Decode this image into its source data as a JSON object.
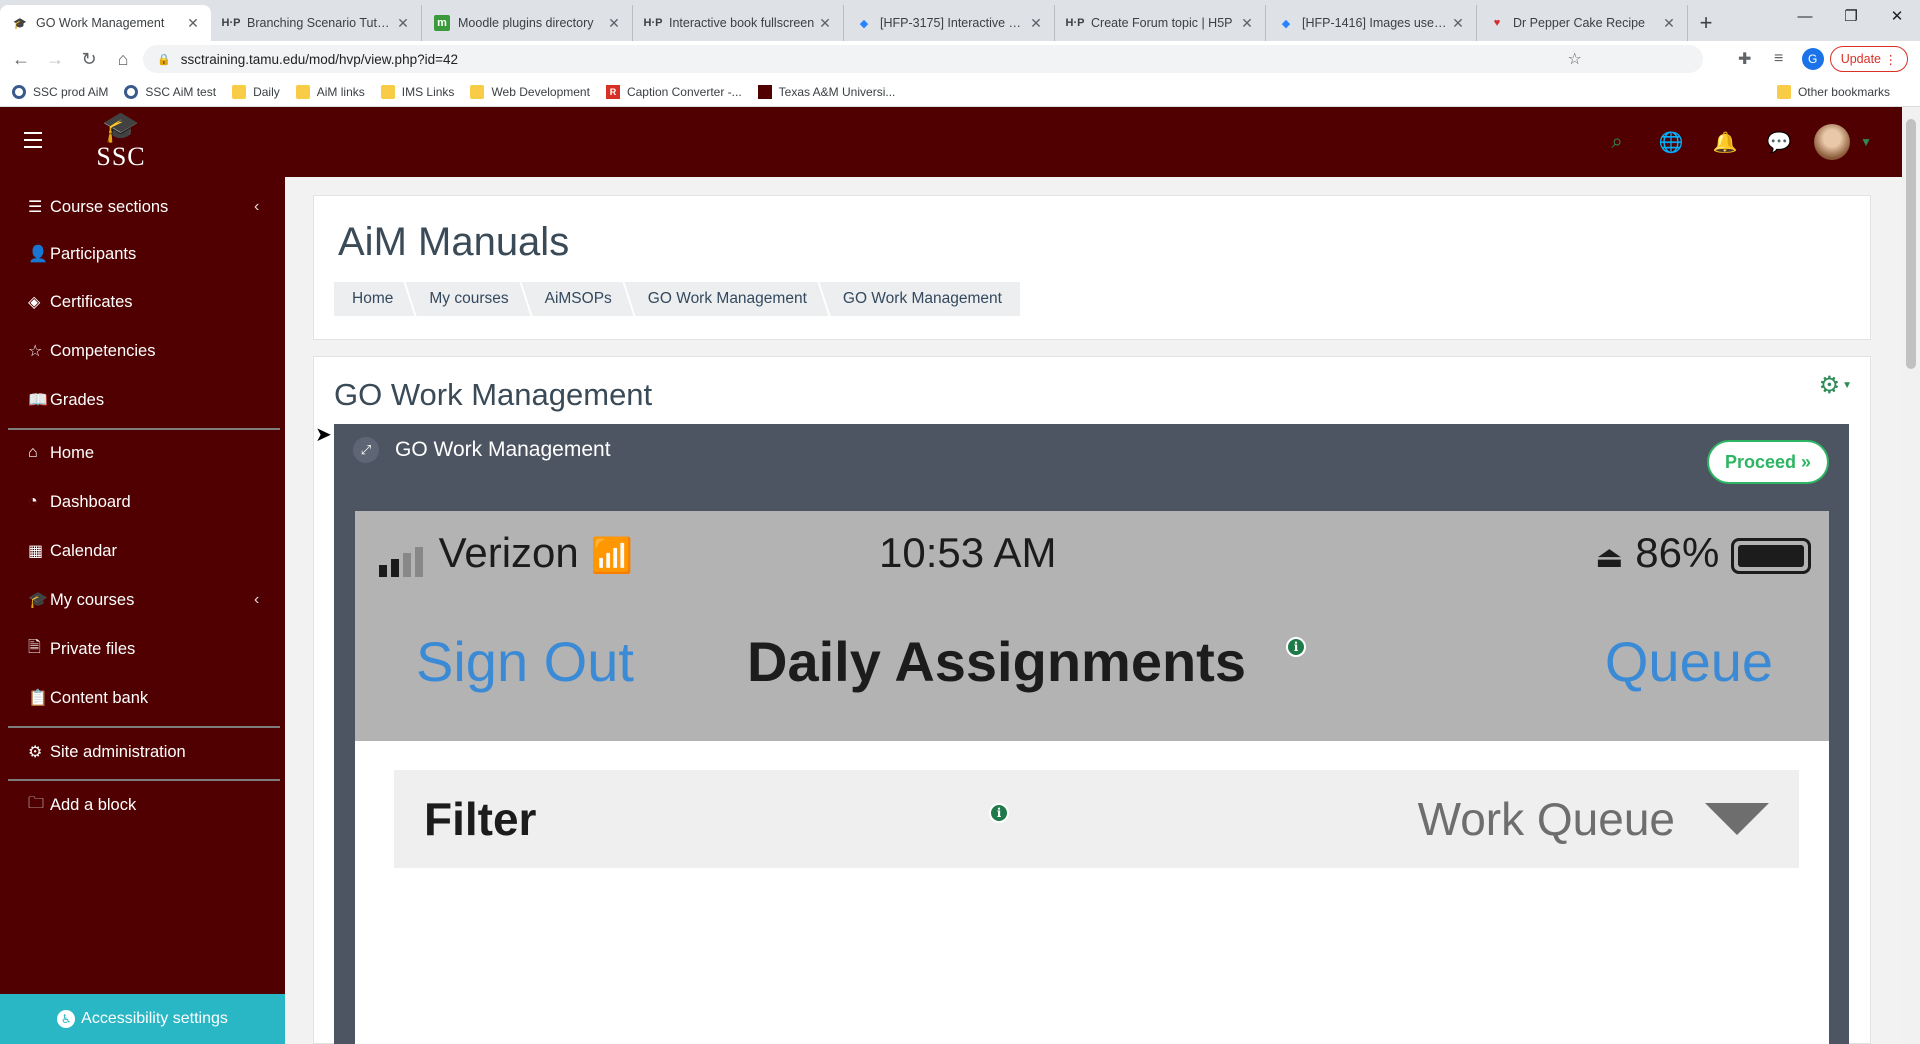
{
  "browser": {
    "tabs": [
      {
        "title": "GO Work Management",
        "favicon": "moodle-icon"
      },
      {
        "title": "Branching Scenario Tutorial",
        "favicon": "h5p-icon"
      },
      {
        "title": "Moodle plugins directory",
        "favicon": "moodle-green-icon"
      },
      {
        "title": "Interactive book fullscreen",
        "favicon": "h5p-icon"
      },
      {
        "title": "[HFP-3175] Interactive Book",
        "favicon": "jira-icon"
      },
      {
        "title": "Create Forum topic | H5P",
        "favicon": "h5p-icon"
      },
      {
        "title": "[HFP-1416] Images uses 100",
        "favicon": "jira-icon"
      },
      {
        "title": "Dr Pepper Cake Recipe",
        "favicon": "heart-icon"
      }
    ],
    "url": "ssctraining.tamu.edu/mod/hvp/view.php?id=42",
    "profile_initial": "G",
    "update_label": "Update",
    "bookmarks": [
      "SSC prod AiM",
      "SSC AiM test",
      "Daily",
      "AiM links",
      "IMS Links",
      "Web Development",
      "Caption Converter -...",
      "Texas A&M Universi..."
    ],
    "other_bookmarks": "Other bookmarks"
  },
  "site": {
    "logo_text": "SSC",
    "accent": "#500000",
    "icon_color": "#2e8b57"
  },
  "drawer": {
    "items": [
      {
        "label": "Course sections",
        "icon": "list-icon"
      },
      {
        "label": "Participants",
        "icon": "user-icon"
      },
      {
        "label": "Certificates",
        "icon": "layers-icon"
      },
      {
        "label": "Competencies",
        "icon": "star-icon"
      },
      {
        "label": "Grades",
        "icon": "book-icon"
      },
      {
        "label": "Home",
        "icon": "home-icon"
      },
      {
        "label": "Dashboard",
        "icon": "gauge-icon"
      },
      {
        "label": "Calendar",
        "icon": "calendar-icon"
      },
      {
        "label": "My courses",
        "icon": "graduation-cap-icon"
      },
      {
        "label": "Private files",
        "icon": "file-icon"
      },
      {
        "label": "Content bank",
        "icon": "clipboard-icon"
      },
      {
        "label": "Site administration",
        "icon": "gear-icon"
      },
      {
        "label": "Add a block",
        "icon": "folder-icon"
      }
    ],
    "accessibility_label": "Accessibility settings"
  },
  "page": {
    "title": "AiM Manuals",
    "breadcrumbs": [
      "Home",
      "My courses",
      "AiMSOPs",
      "GO Work Management",
      "GO Work Management"
    ],
    "activity_title": "GO Work Management"
  },
  "h5p": {
    "title": "GO Work Management",
    "proceed_label": "Proceed »",
    "screenshot": {
      "carrier": "Verizon",
      "time": "10:53 AM",
      "battery": "86%",
      "sign_out": "Sign Out",
      "screen_title": "Daily Assignments",
      "queue": "Queue",
      "filter_label": "Filter",
      "filter_value": "Work Queue"
    }
  }
}
